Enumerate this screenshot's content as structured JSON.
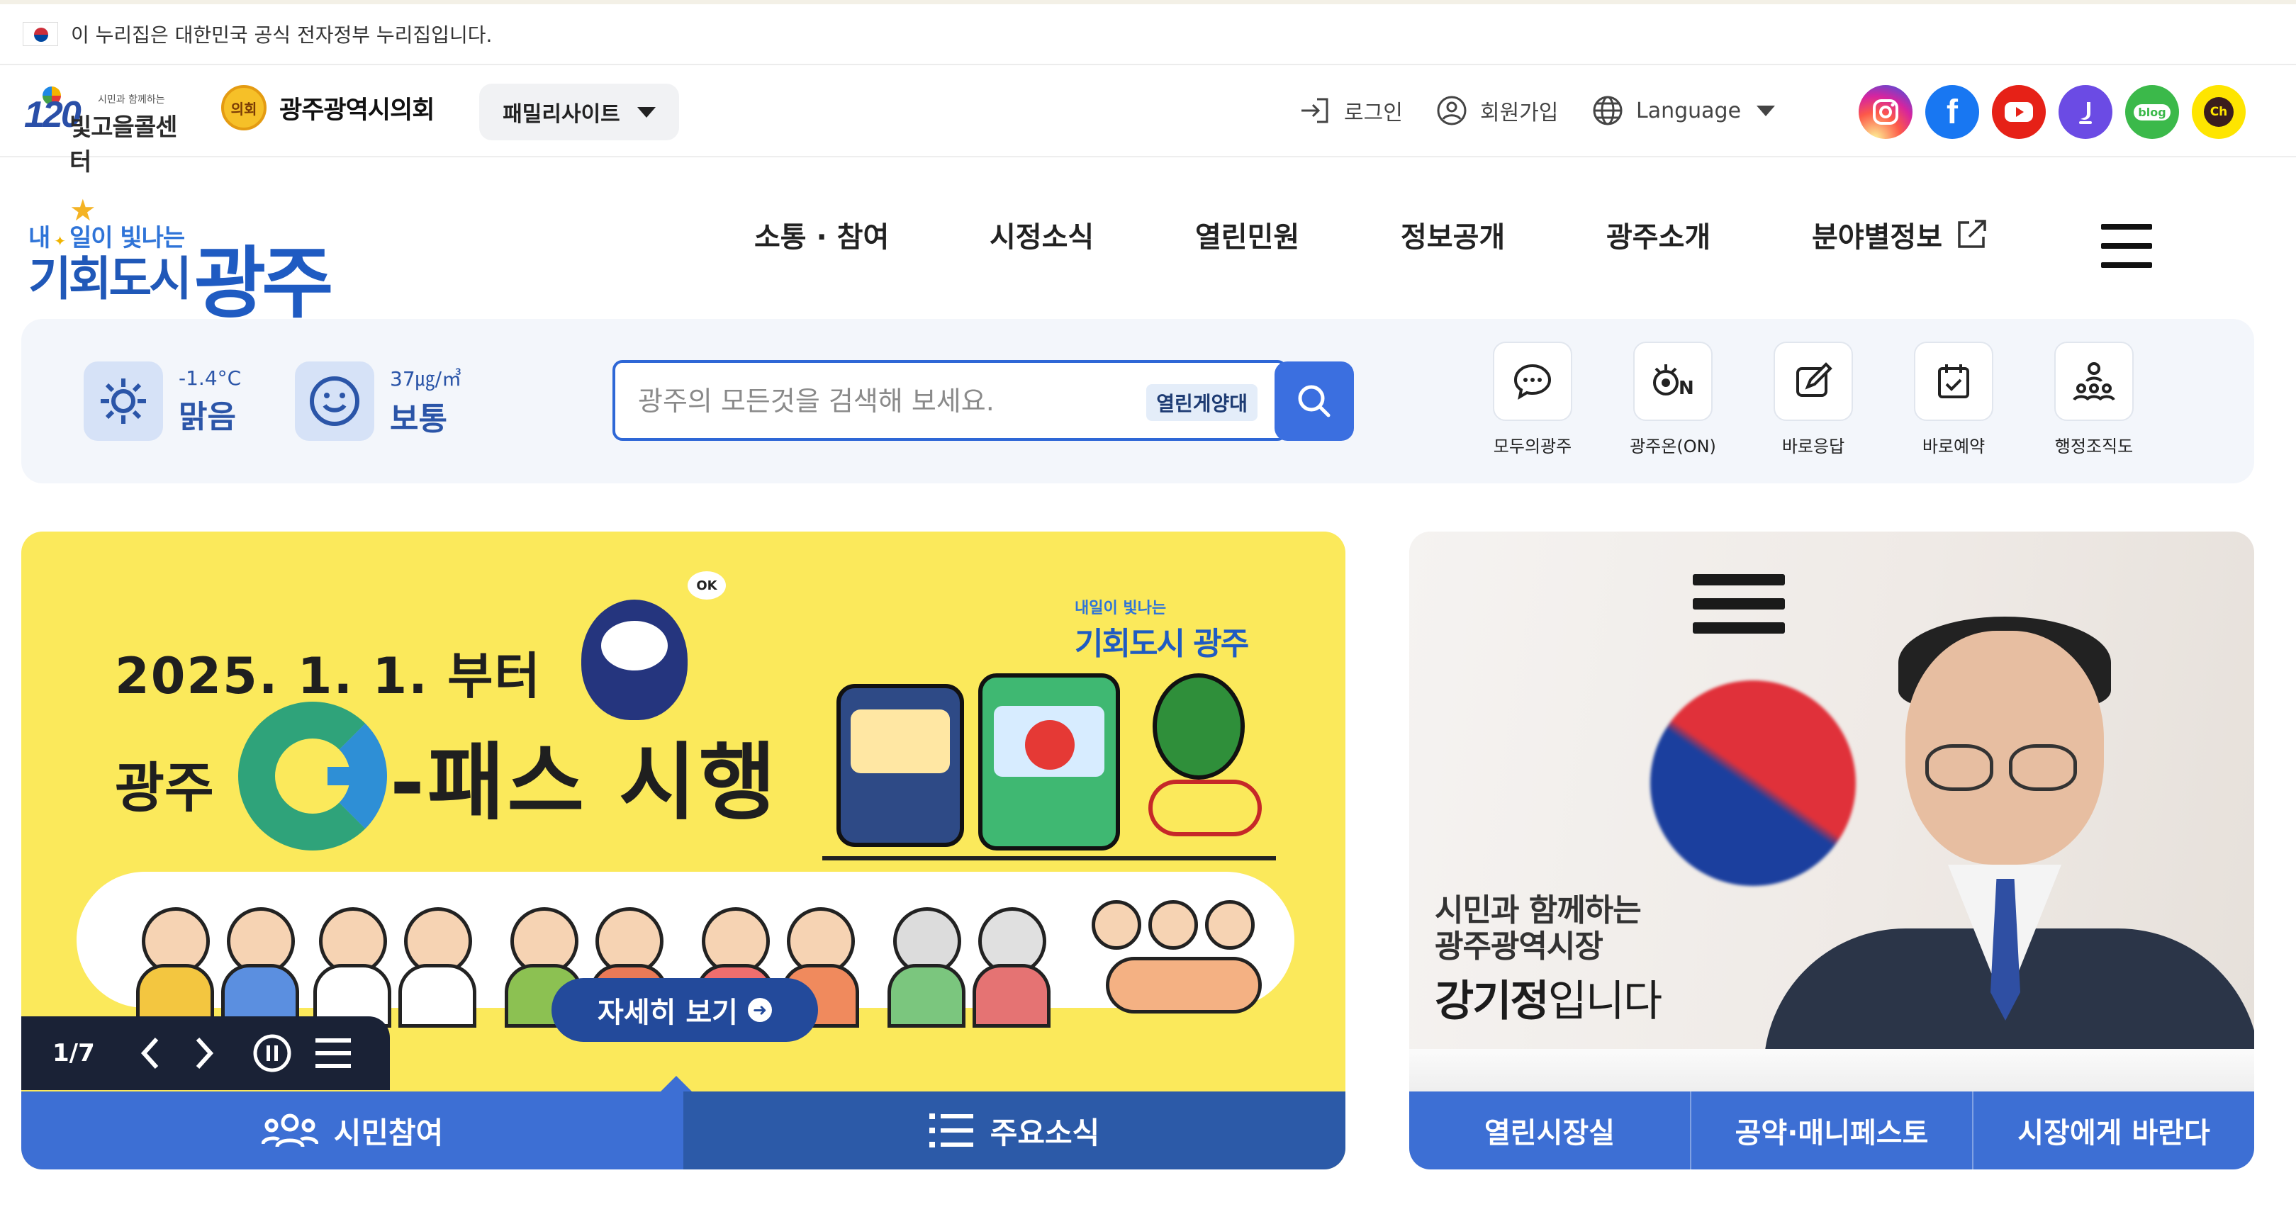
{
  "gov_banner": {
    "text": "이 누리집은 대한민국 공식 전자정부 누리집입니다."
  },
  "utility": {
    "callcenter_small": "시민과 함께하는",
    "callcenter_name": "빛고을콜센터",
    "callcenter_num": "120",
    "council_emblem": "의회",
    "council_name": "광주광역시의회",
    "family_site": "패밀리사이트",
    "login": "로그인",
    "signup": "회원가입",
    "language": "Language",
    "sns": [
      {
        "name": "instagram",
        "color": "#e1306c"
      },
      {
        "name": "facebook",
        "color": "#1877f2",
        "glyph": "f"
      },
      {
        "name": "youtube",
        "color": "#e62117"
      },
      {
        "name": "kakao-story",
        "color": "#6b4be4"
      },
      {
        "name": "blog",
        "color": "#3bb94a",
        "glyph": "blog"
      },
      {
        "name": "kakao-channel",
        "color": "#fee500",
        "glyph": "Ch"
      }
    ]
  },
  "brand": {
    "slogan_a": "내",
    "slogan_b": "일이 빛나는",
    "city": "기회도시",
    "name": "광주"
  },
  "nav": {
    "items": [
      "소통 · 참여",
      "시정소식",
      "열린민원",
      "정보공개",
      "광주소개",
      "분야별정보"
    ]
  },
  "tools": {
    "temp": "-1.4°C",
    "weather": "맑음",
    "dust_value": "37㎍/㎥",
    "dust_status": "보통",
    "search_placeholder": "광주의 모든것을 검색해 보세요.",
    "search_tag": "열린게양대",
    "quick": [
      "모두의광주",
      "광주온(ON)",
      "바로응답",
      "바로예약",
      "행정조직도"
    ]
  },
  "banner": {
    "date": "2025. 1. 1. 부터",
    "gwangju": "광주",
    "pass": "-패스 시행",
    "brand_small": "내일이 빛나는",
    "brand_big": "기회도시 광주",
    "ok": "OK",
    "more": "자세히 보기",
    "counter": "1/7",
    "tabs": [
      "시민참여",
      "주요소식"
    ]
  },
  "mayor": {
    "line1": "시민과 함께하는",
    "line2": "광주광역시장",
    "name": "강기정",
    "suffix": "입니다",
    "tabs": [
      "열린시장실",
      "공약·매니페스토",
      "시장에게 바란다"
    ]
  }
}
